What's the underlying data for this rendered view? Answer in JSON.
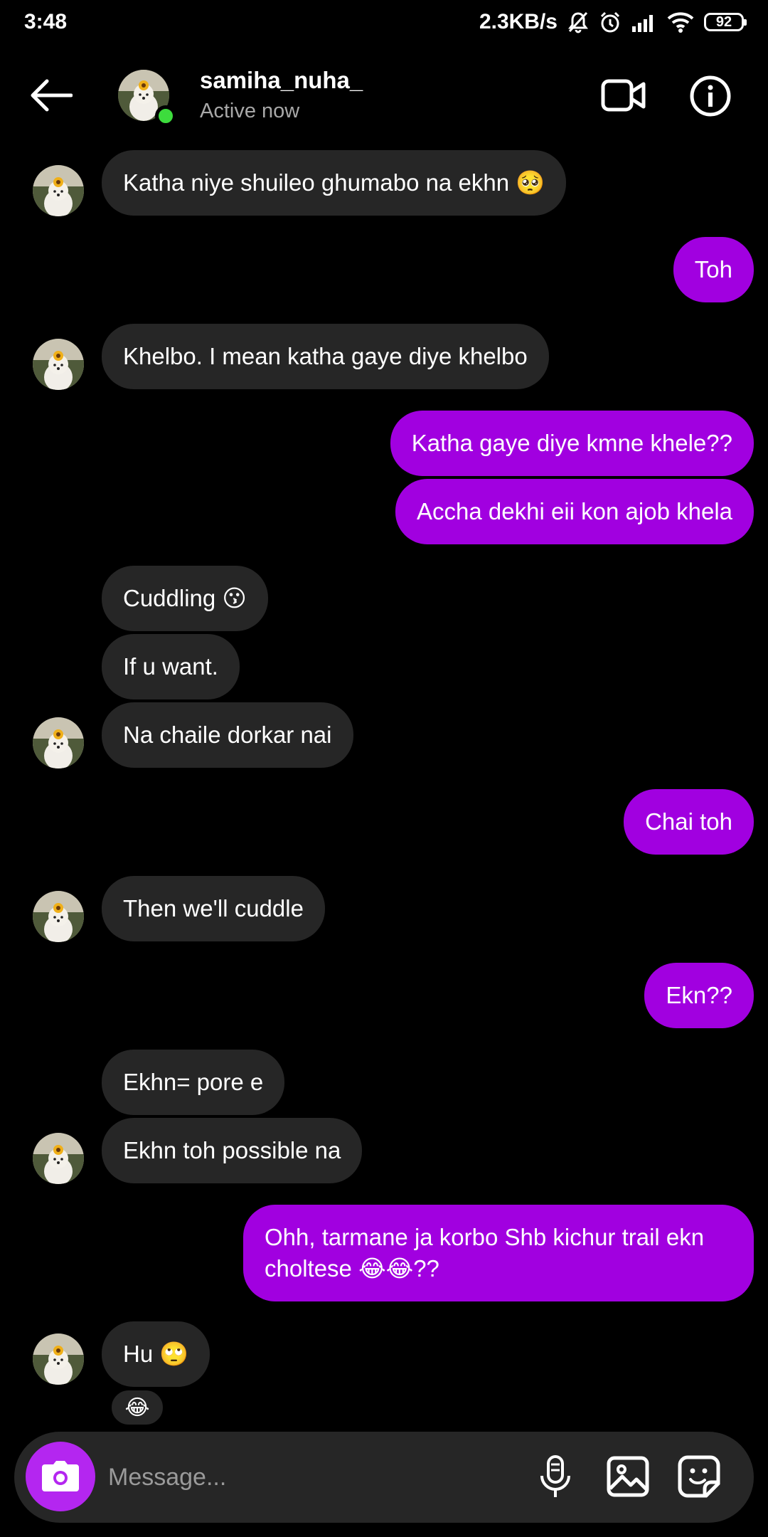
{
  "status_bar": {
    "time": "3:48",
    "net_speed": "2.3KB/s",
    "battery": "92"
  },
  "header": {
    "name": "samiha_nuha_",
    "status": "Active now"
  },
  "messages": [
    {
      "from": "them",
      "text": "Katha niye shuileo ghumabo na ekhn 🥺"
    },
    {
      "from": "me",
      "text": "Toh"
    },
    {
      "from": "them",
      "text": "Khelbo. I mean katha gaye diye khelbo"
    },
    {
      "from": "me",
      "text": "Katha gaye diye kmne khele??"
    },
    {
      "from": "me",
      "text": "Accha dekhi eii kon ajob khela"
    },
    {
      "from": "them",
      "text": "Cuddling  😗"
    },
    {
      "from": "them",
      "text": "If u want."
    },
    {
      "from": "them",
      "text": "Na chaile dorkar nai"
    },
    {
      "from": "me",
      "text": "Chai toh"
    },
    {
      "from": "them",
      "text": "Then we'll cuddle"
    },
    {
      "from": "me",
      "text": "Ekn??"
    },
    {
      "from": "them",
      "text": "Ekhn= pore e"
    },
    {
      "from": "them",
      "text": "Ekhn toh possible na"
    },
    {
      "from": "me",
      "text": "Ohh, tarmane ja korbo Shb kichur trail ekn choltese 😂😂??"
    },
    {
      "from": "them",
      "text": "Hu 🙄"
    }
  ],
  "reaction": "😂",
  "composer": {
    "placeholder": "Message..."
  },
  "colors": {
    "background": "#000000",
    "incoming_bubble": "#262626",
    "outgoing_bubble": "#a100e0",
    "camera_button": "#b426f0",
    "online_dot": "#3ddc3d"
  },
  "icons": [
    "back-arrow-icon",
    "video-call-icon",
    "info-icon",
    "camera-icon",
    "microphone-icon",
    "gallery-icon",
    "sticker-icon",
    "alarm-icon",
    "mute-bell-icon",
    "signal-icon",
    "wifi-icon"
  ]
}
